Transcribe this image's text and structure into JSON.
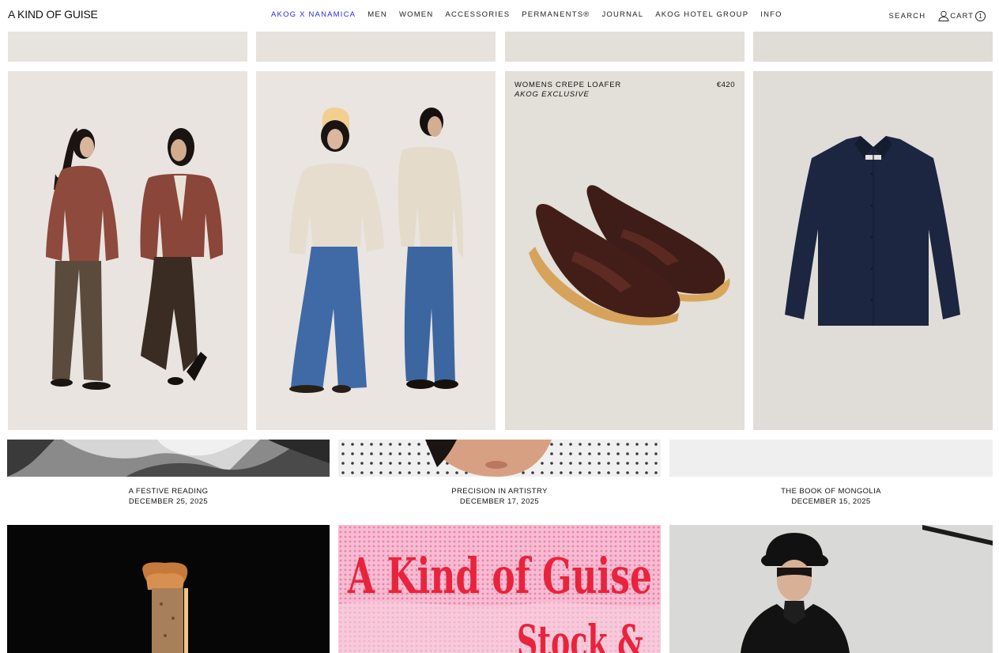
{
  "header": {
    "logo": "A KIND OF GUISE",
    "nav": [
      {
        "label": "AKOG X NANAMICA",
        "active": true
      },
      {
        "label": "MEN",
        "active": false
      },
      {
        "label": "WOMEN",
        "active": false
      },
      {
        "label": "ACCESSORIES",
        "active": false
      },
      {
        "label": "PERMANENTS®",
        "active": false
      },
      {
        "label": "JOURNAL",
        "active": false
      },
      {
        "label": "AKOG HOTEL GROUP",
        "active": false
      },
      {
        "label": "INFO",
        "active": false
      }
    ],
    "search_label": "SEARCH",
    "cart_label": "CART",
    "cart_count": "1"
  },
  "products": {
    "loafer": {
      "name": "WOMENS CREPE LOAFER",
      "subtitle": "AKOG EXCLUSIVE",
      "price": "€420"
    }
  },
  "journal": [
    {
      "title": "A FESTIVE READING",
      "date": "DECEMBER 25, 2025"
    },
    {
      "title": "PRECISION IN ARTISTRY",
      "date": "DECEMBER 17, 2025"
    },
    {
      "title": "THE BOOK OF MONGOLIA",
      "date": "DECEMBER 15, 2025"
    }
  ],
  "poster": {
    "line1": "A Kind of Guise",
    "line2": "Stock &"
  },
  "colors": {
    "accent": "#2a2adf",
    "poster_red": "#e8243c",
    "poster_pink": "#f3a6c4"
  }
}
